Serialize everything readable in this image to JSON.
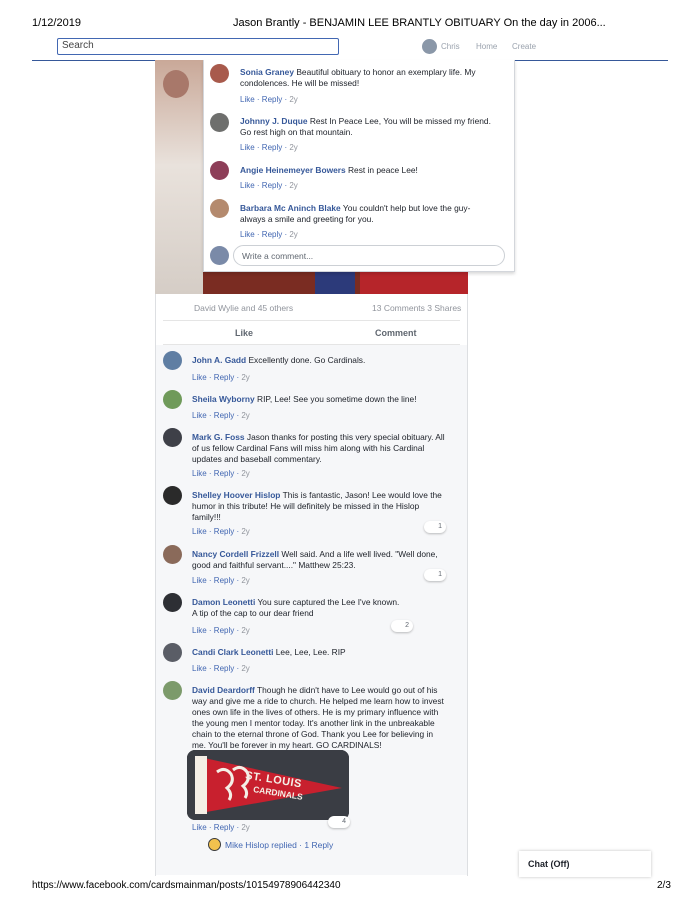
{
  "print_header": {
    "date": "1/12/2019",
    "title": "Jason Brantly - BENJAMIN LEE BRANTLY OBITUARY On the day in 2006..."
  },
  "print_footer": {
    "url": "https://www.facebook.com/cardsmainman/posts/10154978906442340",
    "page": "2/3"
  },
  "topbar": {
    "search_placeholder": "Search",
    "user_name": "Chris",
    "home_label": "Home",
    "create_label": "Create"
  },
  "popup_comments": [
    {
      "name": "Sonia Graney",
      "text_line1": "Beautiful obituary to honor an exemplary life. My",
      "text_line2": "condolences. He will be missed!",
      "like": "Like",
      "reply": "Reply",
      "time": "2y"
    },
    {
      "name": "Johnny J. Duque",
      "text_line1": "Rest In Peace Lee, You will be missed my friend.",
      "text_line2": "Go rest high on that mountain.",
      "like": "Like",
      "reply": "Reply",
      "time": "2y"
    },
    {
      "name": "Angie Heinemeyer Bowers",
      "text_line1": "Rest in peace Lee!",
      "text_line2": "",
      "like": "Like",
      "reply": "Reply",
      "time": "2y"
    },
    {
      "name": "Barbara Mc Aninch Blake",
      "text_line1": "You couldn't help but love the guy-",
      "text_line2": "always a smile and greeting for you.",
      "like": "Like",
      "reply": "Reply",
      "time": "2y"
    }
  ],
  "write_comment_placeholder": "Write a comment...",
  "post_stats": {
    "reactions": "David Wylie and 45 others",
    "counts": "13 Comments  3 Shares"
  },
  "post_buttons": {
    "like": "Like",
    "comment": "Comment"
  },
  "comments": [
    {
      "name": "John A. Gadd",
      "lines": [
        "Excellently done. Go Cardinals."
      ],
      "like": "Like",
      "reply": "Reply",
      "time": "2y",
      "reactions": ""
    },
    {
      "name": "Sheila Wyborny",
      "lines": [
        "RIP, Lee! See you sometime down the line!"
      ],
      "like": "Like",
      "reply": "Reply",
      "time": "2y",
      "reactions": ""
    },
    {
      "name": "Mark G. Foss",
      "lines": [
        "Jason thanks for posting this very special obituary. All",
        "of us fellow Cardinal Fans will miss him along with his Cardinal",
        "updates and baseball commentary."
      ],
      "like": "Like",
      "reply": "Reply",
      "time": "2y",
      "reactions": ""
    },
    {
      "name": "Shelley Hoover Hislop",
      "lines": [
        "This is fantastic, Jason! Lee would love the",
        "humor in this tribute! He will definitely be missed in the Hislop",
        "family!!!"
      ],
      "like": "Like",
      "reply": "Reply",
      "time": "2y",
      "reactions": "1"
    },
    {
      "name": "Nancy Cordell Frizzell",
      "lines": [
        "Well said. And a life well lived. \"Well done,",
        "good and faithful servant....\" Matthew 25:23."
      ],
      "like": "Like",
      "reply": "Reply",
      "time": "2y",
      "reactions": "1"
    },
    {
      "name": "Damon Leonetti",
      "lines": [
        "You sure captured the Lee I've known.",
        "A tip of the cap to our dear friend"
      ],
      "like": "Like",
      "reply": "Reply",
      "time": "2y",
      "reactions": "2"
    },
    {
      "name": "Candi Clark Leonetti",
      "lines": [
        "Lee, Lee, Lee. RIP"
      ],
      "like": "Like",
      "reply": "Reply",
      "time": "2y",
      "reactions": ""
    },
    {
      "name": "David Deardorff",
      "lines": [
        "Though he didn't have to Lee would go out of his",
        "way and give me a ride to church. He helped me learn how to invest",
        "ones own life in the lives of others. He is my primary influence with",
        "the young men I mentor today. It's another link in the unbreakable",
        "chain to the eternal throne of God. Thank you Lee for believing in",
        "me. You'll be forever in my heart. GO CARDINALS!"
      ],
      "like": "Like",
      "reply": "Reply",
      "time": "2y",
      "reactions": "4"
    }
  ],
  "pennant_text": [
    "ST. LOUIS",
    "CARDINALS"
  ],
  "replies_link": {
    "name": "Mike Hislop replied",
    "count": "1 Reply"
  },
  "chat": {
    "label": "Chat (Off)"
  },
  "colors": {
    "link_blue": "#365899",
    "action_blue": "#4267b2",
    "muted": "#90949c",
    "pennant_red": "#c8202e"
  }
}
